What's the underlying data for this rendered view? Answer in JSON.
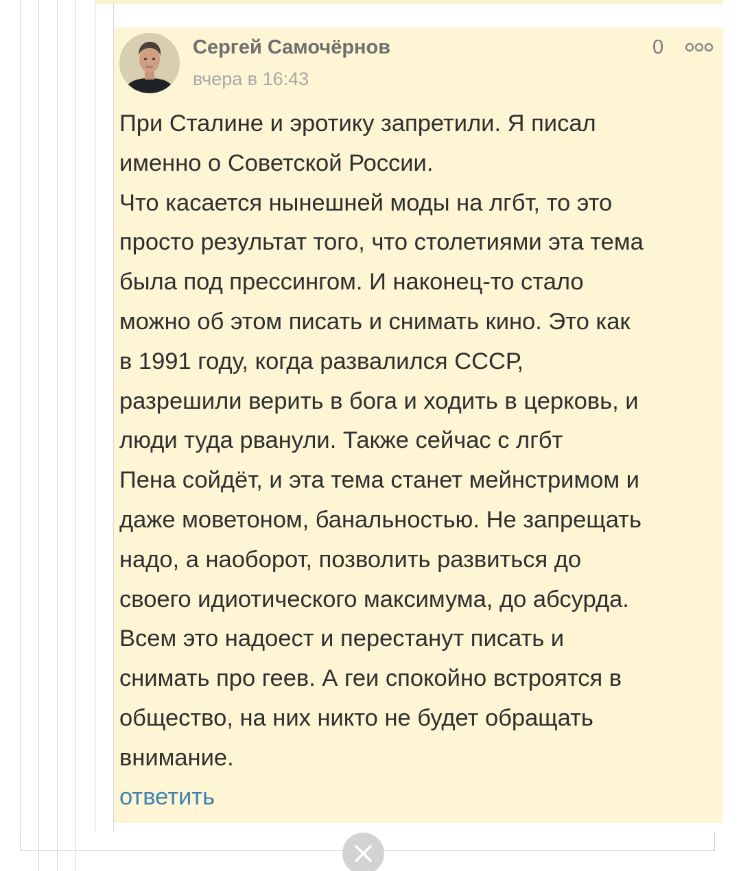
{
  "comment": {
    "author": "Сергей Самочёрнов",
    "timestamp": "вчера в 16:43",
    "rating": "0",
    "more_icon": "ellipsis-icon",
    "text_lines": [
      "При Сталине и эротику запретили. Я писал",
      "именно о Советской России.",
      "Что касается нынешней моды на лгбт, то это",
      "просто результат того, что столетиями эта тема",
      "была под прессингом. И наконец-то стало",
      "можно об этом писать и снимать кино. Это как",
      "в 1991 году, когда развалился СССР,",
      "разрешили верить в бога и ходить в церковь, и",
      "люди туда рванули. Также сейчас с лгбт",
      "Пена сойдёт, и эта тема станет мейнстримом и",
      "даже моветоном, банальностью. Не запрещать",
      "надо, а наоборот, позволить развиться до",
      "своего идиотического максимума, до абсурда.",
      "Всем это надоест и перестанут писать и",
      "снимать про геев. А геи спокойно встроятся в",
      "общество, на них никто не будет обращать",
      "внимание."
    ],
    "reply_label": "ответить"
  },
  "close_icon": "close-icon",
  "colors": {
    "comment_background": "#fdf5d3",
    "author_text": "#6f6f6f",
    "timestamp_text": "#a8a8a8",
    "body_text": "#2f2f2f",
    "reply_link": "#3f82b3",
    "close_button": "#d3d3d3"
  }
}
